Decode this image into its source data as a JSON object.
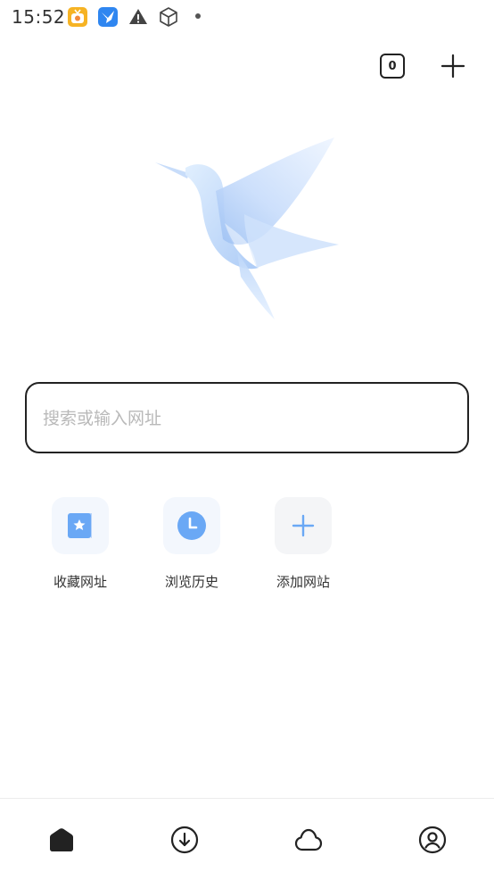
{
  "status_bar": {
    "time": "15:52",
    "icons": [
      "tv-app-icon",
      "bird-app-icon",
      "warning-icon",
      "cube-icon",
      "dot-icon"
    ]
  },
  "header": {
    "tab_count": "0",
    "new_tab_icon": "plus-icon"
  },
  "logo": {
    "icon": "hummingbird-logo"
  },
  "search": {
    "placeholder": "搜索或输入网址",
    "value": ""
  },
  "shortcuts": [
    {
      "label": "收藏网址",
      "icon": "bookmark-star-icon"
    },
    {
      "label": "浏览历史",
      "icon": "history-clock-icon"
    },
    {
      "label": "添加网站",
      "icon": "add-plus-icon"
    }
  ],
  "bottom_nav": [
    {
      "icon": "home-icon",
      "active": true
    },
    {
      "icon": "download-icon",
      "active": false
    },
    {
      "icon": "cloud-icon",
      "active": false
    },
    {
      "icon": "profile-icon",
      "active": false
    }
  ],
  "colors": {
    "accent_blue": "#6aa8f5",
    "tile_bg": "#f3f7fd",
    "text_dark": "#222222",
    "placeholder": "#b9b9b9"
  }
}
